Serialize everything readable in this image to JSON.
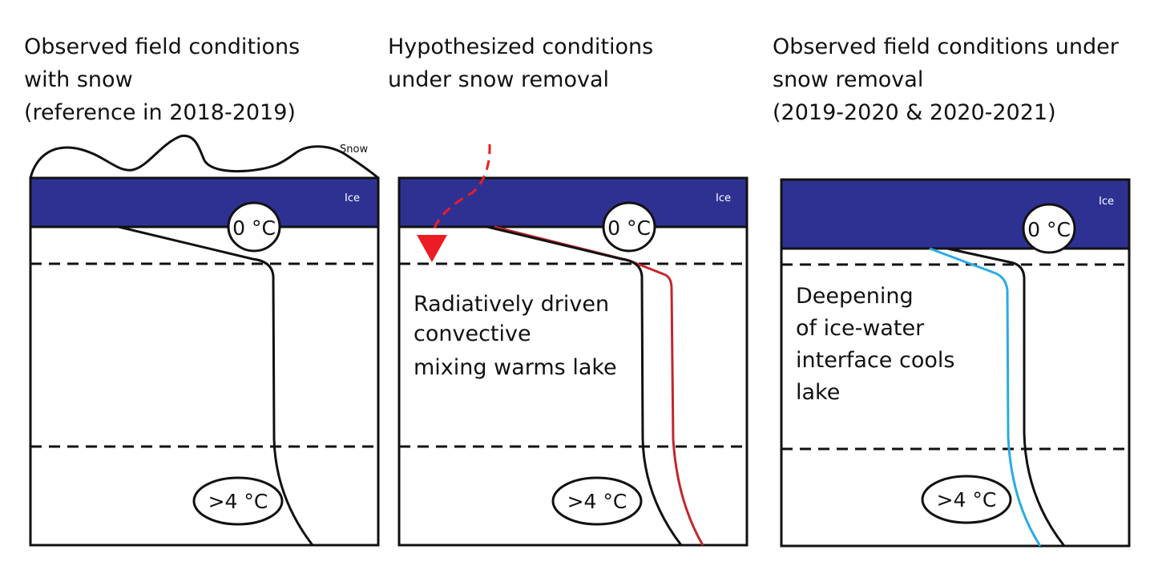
{
  "colors": {
    "ice": "#2e3192",
    "profile": "#111111",
    "hypothesized_profile": "#c1272d",
    "observed_removal_profile": "#29abe2",
    "radiation_arrow": "#ed1c24",
    "background": "#ffffff"
  },
  "panels": [
    {
      "title": "Observed field conditions\nwith snow\n(reference in 2018-2019)",
      "snow_label": "Snow",
      "ice_label": "Ice",
      "top_temp": "0 °C",
      "bottom_temp": ">4 °C"
    },
    {
      "title": "Hypothesized conditions\nunder snow removal",
      "ice_label": "Ice",
      "top_temp": "0 °C",
      "bottom_temp": ">4 °C",
      "annotation": [
        "Radiatively driven",
        "convective",
        "mixing warms lake"
      ]
    },
    {
      "title": "Observed field conditions under\nsnow removal\n(2019-2020 & 2020-2021)",
      "ice_label": "Ice",
      "top_temp": "0 °C",
      "bottom_temp": ">4 °C",
      "annotation": [
        "Deepening",
        "of ice-water",
        "interface cools",
        "lake"
      ]
    }
  ]
}
